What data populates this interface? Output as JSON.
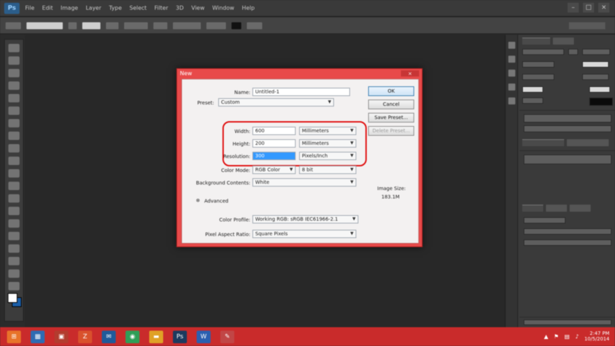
{
  "menubar": {
    "logo": "Ps",
    "items": [
      "File",
      "Edit",
      "Image",
      "Layer",
      "Type",
      "Select",
      "Filter",
      "3D",
      "View",
      "Window",
      "Help"
    ],
    "window_controls": [
      "–",
      "□",
      "×"
    ]
  },
  "dialog": {
    "title": "New",
    "close": "×",
    "name_label": "Name:",
    "name_value": "Untitled-1",
    "preset_label": "Preset:",
    "preset_value": "Custom",
    "width_label": "Width:",
    "width_value": "600",
    "width_unit": "Millimeters",
    "height_label": "Height:",
    "height_value": "200",
    "height_unit": "Millimeters",
    "resolution_label": "Resolution:",
    "resolution_value": "300",
    "resolution_unit": "Pixels/Inch",
    "color_mode_label": "Color Mode:",
    "color_mode_value": "RGB Color",
    "bit_depth_value": "8 bit",
    "background_label": "Background Contents:",
    "background_value": "White",
    "advanced_label": "Advanced",
    "color_profile_label": "Color Profile:",
    "color_profile_value": "Working RGB: sRGB IEC61966-2.1",
    "pixel_aspect_label": "Pixel Aspect Ratio:",
    "pixel_aspect_value": "Square Pixels",
    "ok_label": "OK",
    "cancel_label": "Cancel",
    "save_preset_label": "Save Preset...",
    "delete_preset_label": "Delete Preset...",
    "image_size_label": "Image Size:",
    "image_size_value": "183.1M"
  },
  "taskbar": {
    "icons": [
      "start",
      "explorer",
      "store",
      "filezilla",
      "mail",
      "chrome",
      "folder",
      "photoshop",
      "word",
      "paint"
    ],
    "clock_time": "2:47 PM",
    "clock_date": "10/5/2014"
  },
  "colors": {
    "dialog_frame": "#e84a4a",
    "taskbar": "#c92b2b",
    "highlight": "#e01010",
    "workspace": "#282828"
  }
}
